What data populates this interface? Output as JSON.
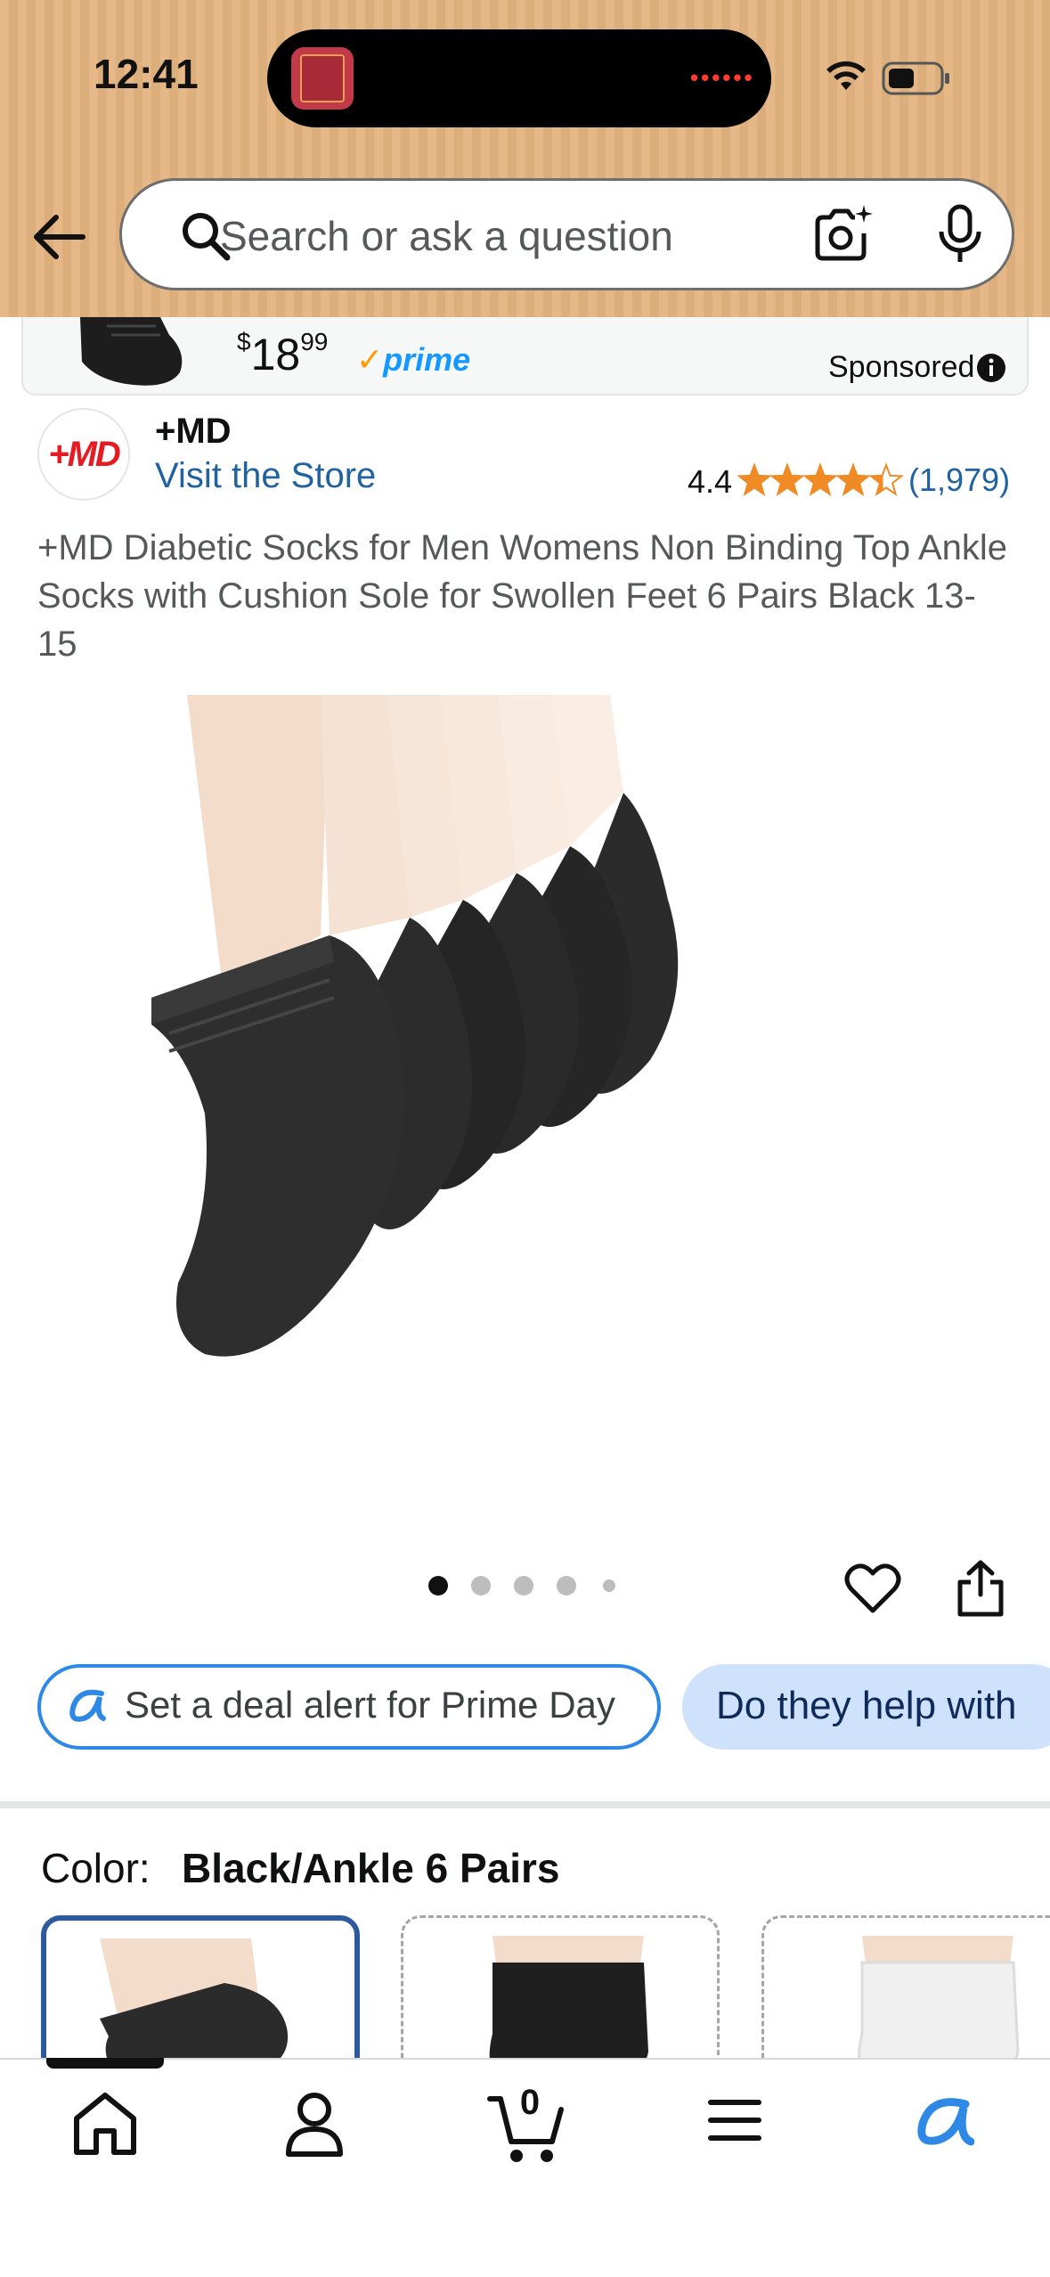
{
  "status_bar": {
    "time": "12:41",
    "island_dots": "••••••"
  },
  "search": {
    "placeholder": "Search or ask a question"
  },
  "sponsored": {
    "price_symbol": "$",
    "price_whole": "18",
    "price_fraction": "99",
    "prime": "prime",
    "label": "Sponsored"
  },
  "brand": {
    "logo_text": "+MD",
    "name": "+MD",
    "visit_store": "Visit the Store",
    "rating": "4.4",
    "rating_fraction": 0.88,
    "rating_count": "(1,979)"
  },
  "product": {
    "title": "+MD Diabetic Socks for Men Womens Non Binding Top Ankle Socks with Cushion Sole for Swollen Feet 6 Pairs Black 13-15",
    "image_count": 5,
    "active_image": 1
  },
  "chips": {
    "deal_alert": "Set a deal alert for Prime Day",
    "question": "Do they help with"
  },
  "color": {
    "label": "Color:",
    "value": "Black/Ankle 6 Pairs"
  },
  "bottom_nav": {
    "cart_count": "0"
  },
  "colors": {
    "header": "#e6b887",
    "link": "#2162a1",
    "prime": "#1399ff",
    "star": "#f08a24"
  }
}
